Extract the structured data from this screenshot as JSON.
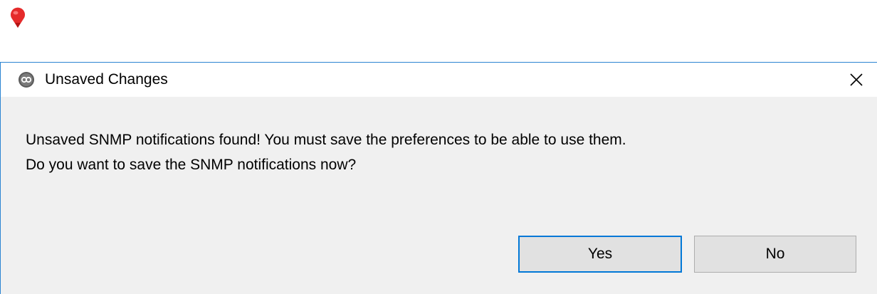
{
  "background_marker": {
    "icon": "map-pin-icon",
    "color": "#e52b2b"
  },
  "dialog": {
    "title": "Unsaved Changes",
    "app_icon": "app-logo-icon",
    "close_icon": "close-icon",
    "message_lines": [
      "Unsaved SNMP notifications found! You must save the preferences to be able to use them.",
      "Do you want to save the SNMP notifications now?"
    ],
    "buttons": {
      "yes_label": "Yes",
      "no_label": "No"
    },
    "colors": {
      "border": "#2b84d2",
      "default_button_border": "#0078d7",
      "body_background": "#f0f0f0"
    }
  }
}
